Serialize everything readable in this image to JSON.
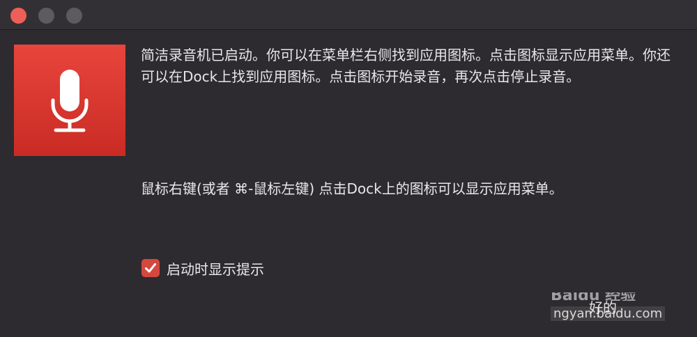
{
  "window": {
    "controls": [
      "close",
      "minimize",
      "maximize"
    ]
  },
  "app_icon": "microphone-icon",
  "message": {
    "intro": "简洁录音机已启动。你可以在菜单栏右侧找到应用图标。点击图标显示应用菜单。你还可以在Dock上找到应用图标。点击图标开始录音，再次点击停止录音。",
    "tip": "鼠标右键(或者 ⌘-鼠标左键) 点击Dock上的图标可以显示应用菜单。"
  },
  "option": {
    "checked": true,
    "label": "启动时显示提示"
  },
  "watermark": {
    "brand": "Baidu 经验",
    "main": "好的",
    "sub": "ngyan.baidu.com"
  },
  "colors": {
    "accent": "#d5483e",
    "icon_bg": "#d8362e",
    "window_bg": "#2d2b2f",
    "text": "#e9e7ea"
  }
}
